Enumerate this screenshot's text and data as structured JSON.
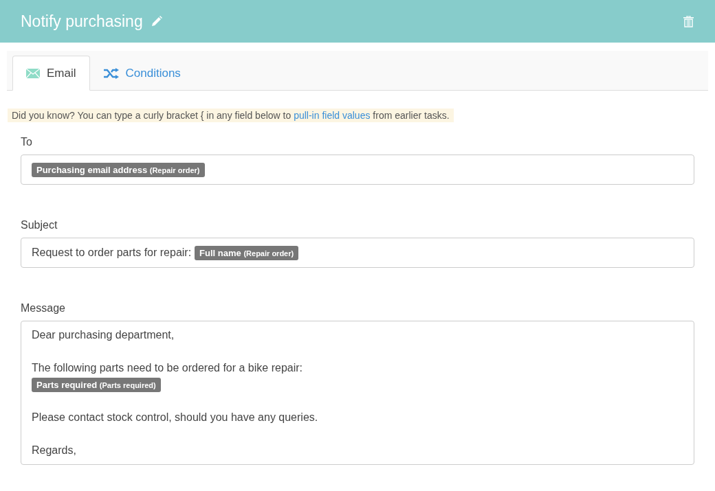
{
  "header": {
    "title": "Notify purchasing"
  },
  "tabs": [
    {
      "label": "Email",
      "kind": "email",
      "selected": true
    },
    {
      "label": "Conditions",
      "kind": "conditions",
      "selected": false
    }
  ],
  "hint": {
    "before": "Did you know? You can type a curly bracket { in any field below to ",
    "link": "pull-in field values",
    "after": " from earlier tasks."
  },
  "fields": [
    {
      "label": "To",
      "kind": "input",
      "lines": [
        {
          "kind": "line",
          "parts": [
            {
              "kind": "token",
              "name": "Purchasing email address",
              "source": "(Repair order)"
            }
          ]
        }
      ]
    },
    {
      "label": "Subject",
      "kind": "input",
      "lines": [
        {
          "kind": "line",
          "parts": [
            {
              "kind": "text",
              "text": "Request to order parts for repair:"
            },
            {
              "kind": "token",
              "name": "Full name",
              "source": "(Repair order)"
            }
          ]
        }
      ]
    },
    {
      "label": "Message",
      "kind": "textarea",
      "lines": [
        {
          "kind": "line",
          "parts": [
            {
              "kind": "text",
              "text": "Dear purchasing department,"
            }
          ]
        },
        {
          "kind": "blank"
        },
        {
          "kind": "line",
          "parts": [
            {
              "kind": "text",
              "text": "The following parts need to be ordered for a bike repair:"
            }
          ]
        },
        {
          "kind": "line",
          "parts": [
            {
              "kind": "token",
              "name": "Parts required",
              "source": "(Parts required)"
            }
          ]
        },
        {
          "kind": "blank"
        },
        {
          "kind": "line",
          "parts": [
            {
              "kind": "text",
              "text": "Please contact stock control, should you have any queries."
            }
          ]
        },
        {
          "kind": "blank"
        },
        {
          "kind": "line",
          "parts": [
            {
              "kind": "text",
              "text": "Regards,"
            }
          ]
        }
      ]
    }
  ]
}
